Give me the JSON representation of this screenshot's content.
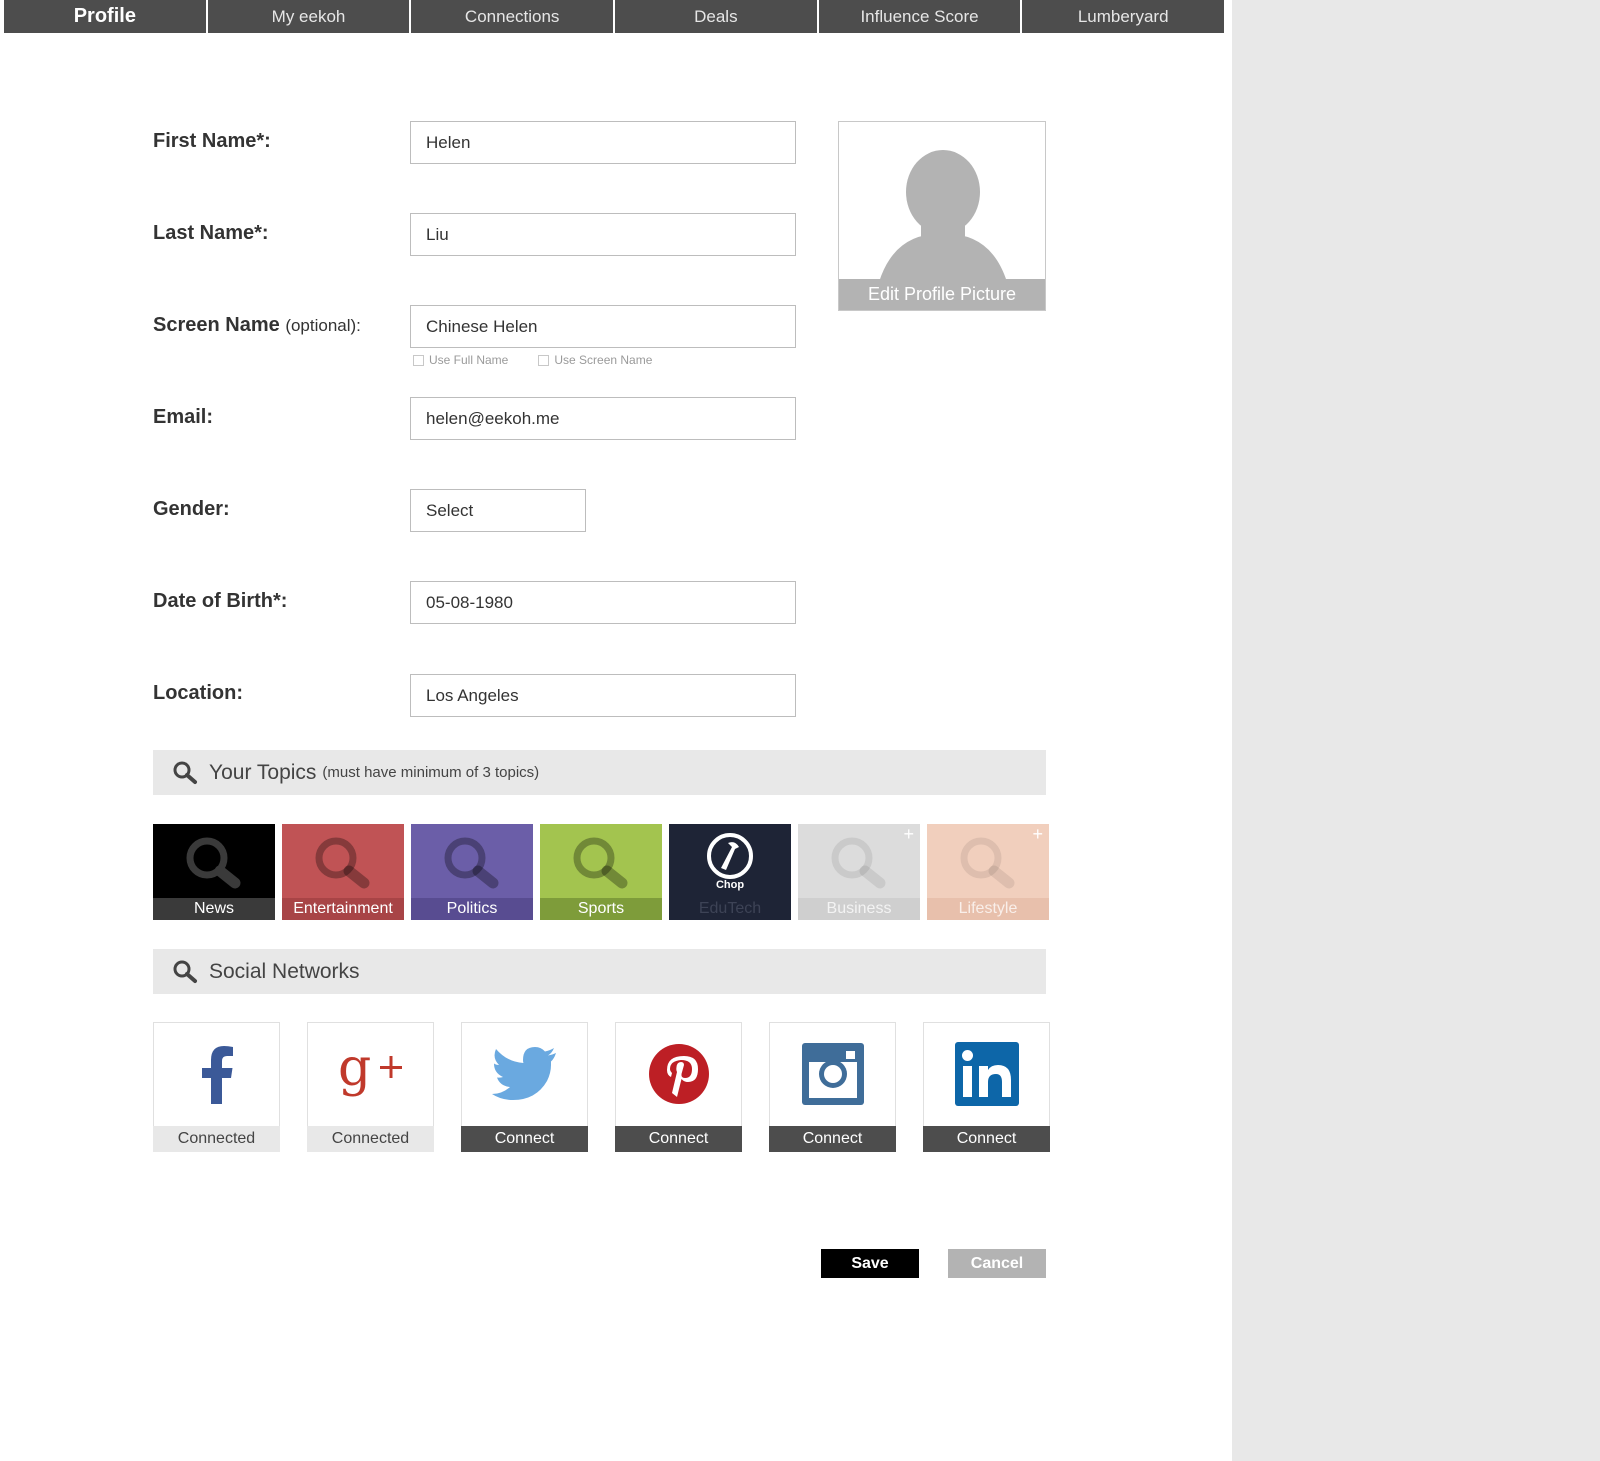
{
  "nav": {
    "tabs": [
      {
        "label": "Profile",
        "active": true
      },
      {
        "label": "My eekoh"
      },
      {
        "label": "Connections"
      },
      {
        "label": "Deals"
      },
      {
        "label": "Influence Score"
      },
      {
        "label": "Lumberyard"
      }
    ]
  },
  "form": {
    "first_name": {
      "label": "First Name*:",
      "value": "Helen"
    },
    "last_name": {
      "label": "Last Name*:",
      "value": "Liu"
    },
    "screen_name": {
      "label": "Screen Name",
      "label_suffix": "(optional):",
      "value": "Chinese Helen"
    },
    "screen_name_options": [
      "Use Full Name",
      "Use Screen Name"
    ],
    "email": {
      "label": "Email:",
      "value": "helen@eekoh.me"
    },
    "gender": {
      "label": "Gender:",
      "value": "Select"
    },
    "dob": {
      "label": "Date of Birth*:",
      "value": "05-08-1980"
    },
    "location": {
      "label": "Location:",
      "value": "Los Angeles"
    }
  },
  "avatar": {
    "edit_label": "Edit Profile Picture"
  },
  "topics": {
    "title": "Your Topics",
    "note": "(must have minimum of 3 topics)",
    "items": [
      {
        "label": "News",
        "bg": "#000000",
        "bar": "#3a3a3a",
        "icon": "magnifier-icon",
        "selected": true
      },
      {
        "label": "Entertainment",
        "bg": "#c05355",
        "bar": "#a84446",
        "icon": "magnifier-icon",
        "selected": true
      },
      {
        "label": "Politics",
        "bg": "#6b5ea8",
        "bar": "#584c91",
        "icon": "magnifier-icon",
        "selected": true
      },
      {
        "label": "Sports",
        "bg": "#a3c44f",
        "bar": "#7e9c3a",
        "icon": "magnifier-icon",
        "selected": true
      },
      {
        "label": "EduTech",
        "brand": "Chop",
        "bg": "#1e2436",
        "bar": "#1e2436",
        "icon": "axe-icon",
        "selected": true
      },
      {
        "label": "Business",
        "bg": "#dcdcdc",
        "bar": "#cfcfcf",
        "icon": "magnifier-icon",
        "selected": false
      },
      {
        "label": "Lifestyle",
        "bg": "#f1cfbd",
        "bar": "#e8c0ac",
        "icon": "magnifier-icon",
        "selected": false
      }
    ]
  },
  "social": {
    "title": "Social Networks",
    "items": [
      {
        "network": "facebook",
        "icon": "facebook-icon",
        "status": "Connected",
        "color": "#3b5998"
      },
      {
        "network": "google-plus",
        "icon": "google-plus-icon",
        "status": "Connected",
        "color": "#c0392b"
      },
      {
        "network": "twitter",
        "icon": "twitter-icon",
        "status": "Connect",
        "color": "#6aa9e0"
      },
      {
        "network": "pinterest",
        "icon": "pinterest-icon",
        "status": "Connect",
        "color": "#bd1f25"
      },
      {
        "network": "instagram",
        "icon": "instagram-icon",
        "status": "Connect",
        "color": "#3f6d99"
      },
      {
        "network": "linkedin",
        "icon": "linkedin-icon",
        "status": "Connect",
        "color": "#0d66a8"
      }
    ]
  },
  "actions": {
    "save": "Save",
    "cancel": "Cancel"
  }
}
